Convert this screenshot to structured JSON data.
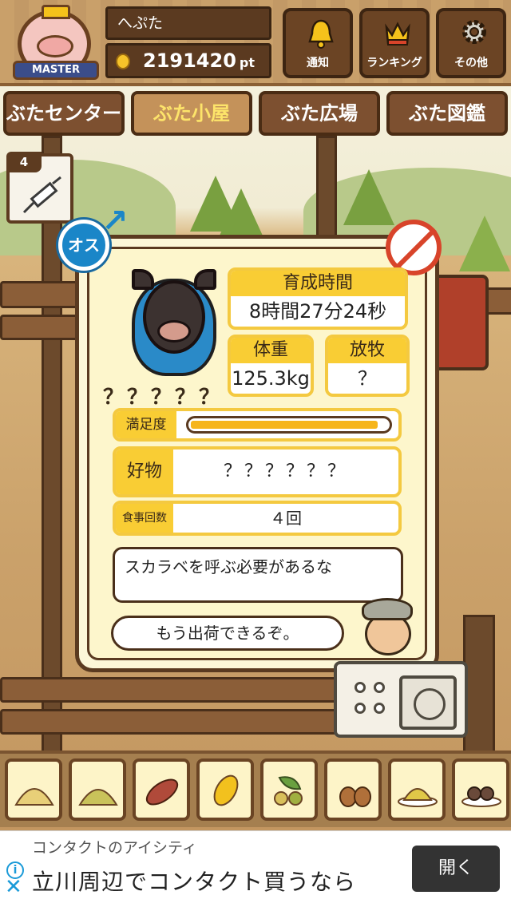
{
  "header": {
    "badge_label": "MASTER",
    "player_name": "へぷた",
    "points": "2191420",
    "points_unit": "pt",
    "buttons": [
      {
        "label": "通知",
        "icon": "bell-icon"
      },
      {
        "label": "ランキング",
        "icon": "crown-icon"
      },
      {
        "label": "その他",
        "icon": "gear-icon"
      }
    ]
  },
  "tabs": [
    {
      "label": "ぶたセンター",
      "active": false
    },
    {
      "label": "ぶた小屋",
      "active": true
    },
    {
      "label": "ぶた広場",
      "active": false
    },
    {
      "label": "ぶた図鑑",
      "active": false
    }
  ],
  "syringe": {
    "count": "4",
    "icon": "syringe-icon"
  },
  "status": {
    "gender_label": "オス",
    "pig_name": "？？？？？",
    "growth_time_label": "育成時間",
    "growth_time_value": "8時間27分24秒",
    "weight_label": "体重",
    "weight_value": "125.3kg",
    "pasture_label": "放牧",
    "pasture_value": "？",
    "satisfaction_label": "満足度",
    "satisfaction_level": 0.95,
    "favorite_label": "好物",
    "favorite_value": "？？？？？？",
    "meals_label": "食事回数",
    "meals_value": "４回",
    "message_main": "スカラベを呼ぶ必要があるな",
    "message_sub": "もう出荷できるぞ。"
  },
  "food_items": [
    {
      "name": "grain-pile-icon"
    },
    {
      "name": "mixed-grain-icon"
    },
    {
      "name": "sweet-potato-icon"
    },
    {
      "name": "corn-icon"
    },
    {
      "name": "beans-icon"
    },
    {
      "name": "acorn-icon"
    },
    {
      "name": "grain-plate-icon"
    },
    {
      "name": "meatball-plate-icon"
    }
  ],
  "ad": {
    "advertiser": "コンタクトのアイシティ",
    "headline": "立川周辺でコンタクト買うなら",
    "cta": "開く"
  },
  "colors": {
    "accent_yellow": "#f9cd34",
    "wood_dark": "#5a3a20",
    "gender_blue": "#1a86c8",
    "no_injection_red": "#d8442a"
  }
}
